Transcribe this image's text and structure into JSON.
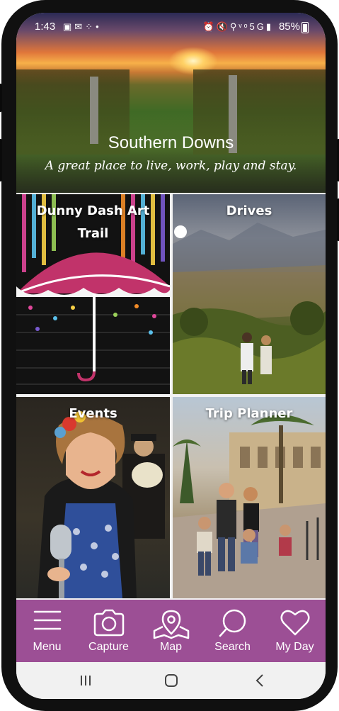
{
  "status_bar": {
    "time": "1:43",
    "left_icons": [
      "image-icon",
      "email-icon",
      "dots-icon",
      "dot-icon"
    ],
    "right_icons": [
      "alarm-icon",
      "mute-icon",
      "location-icon",
      "volte-icon",
      "5g-icon",
      "signal-icon"
    ],
    "network_label": "5G",
    "battery": "85%"
  },
  "hero": {
    "title": "Southern Downs",
    "tagline": "A great place to live, work, play and stay."
  },
  "tiles": [
    {
      "label": "Dunny Dash Art Trail"
    },
    {
      "label": "Drives"
    },
    {
      "label": "Events"
    },
    {
      "label": "Trip Planner"
    }
  ],
  "bottom_nav": {
    "accent": "#9c4f95",
    "items": [
      {
        "label": "Menu",
        "icon": "menu-icon"
      },
      {
        "label": "Capture",
        "icon": "camera-icon"
      },
      {
        "label": "Map",
        "icon": "map-pin-icon"
      },
      {
        "label": "Search",
        "icon": "search-icon"
      },
      {
        "label": "My Day",
        "icon": "heart-icon"
      }
    ]
  },
  "system_nav": {
    "items": [
      "recent-apps-icon",
      "home-icon",
      "back-icon"
    ]
  }
}
